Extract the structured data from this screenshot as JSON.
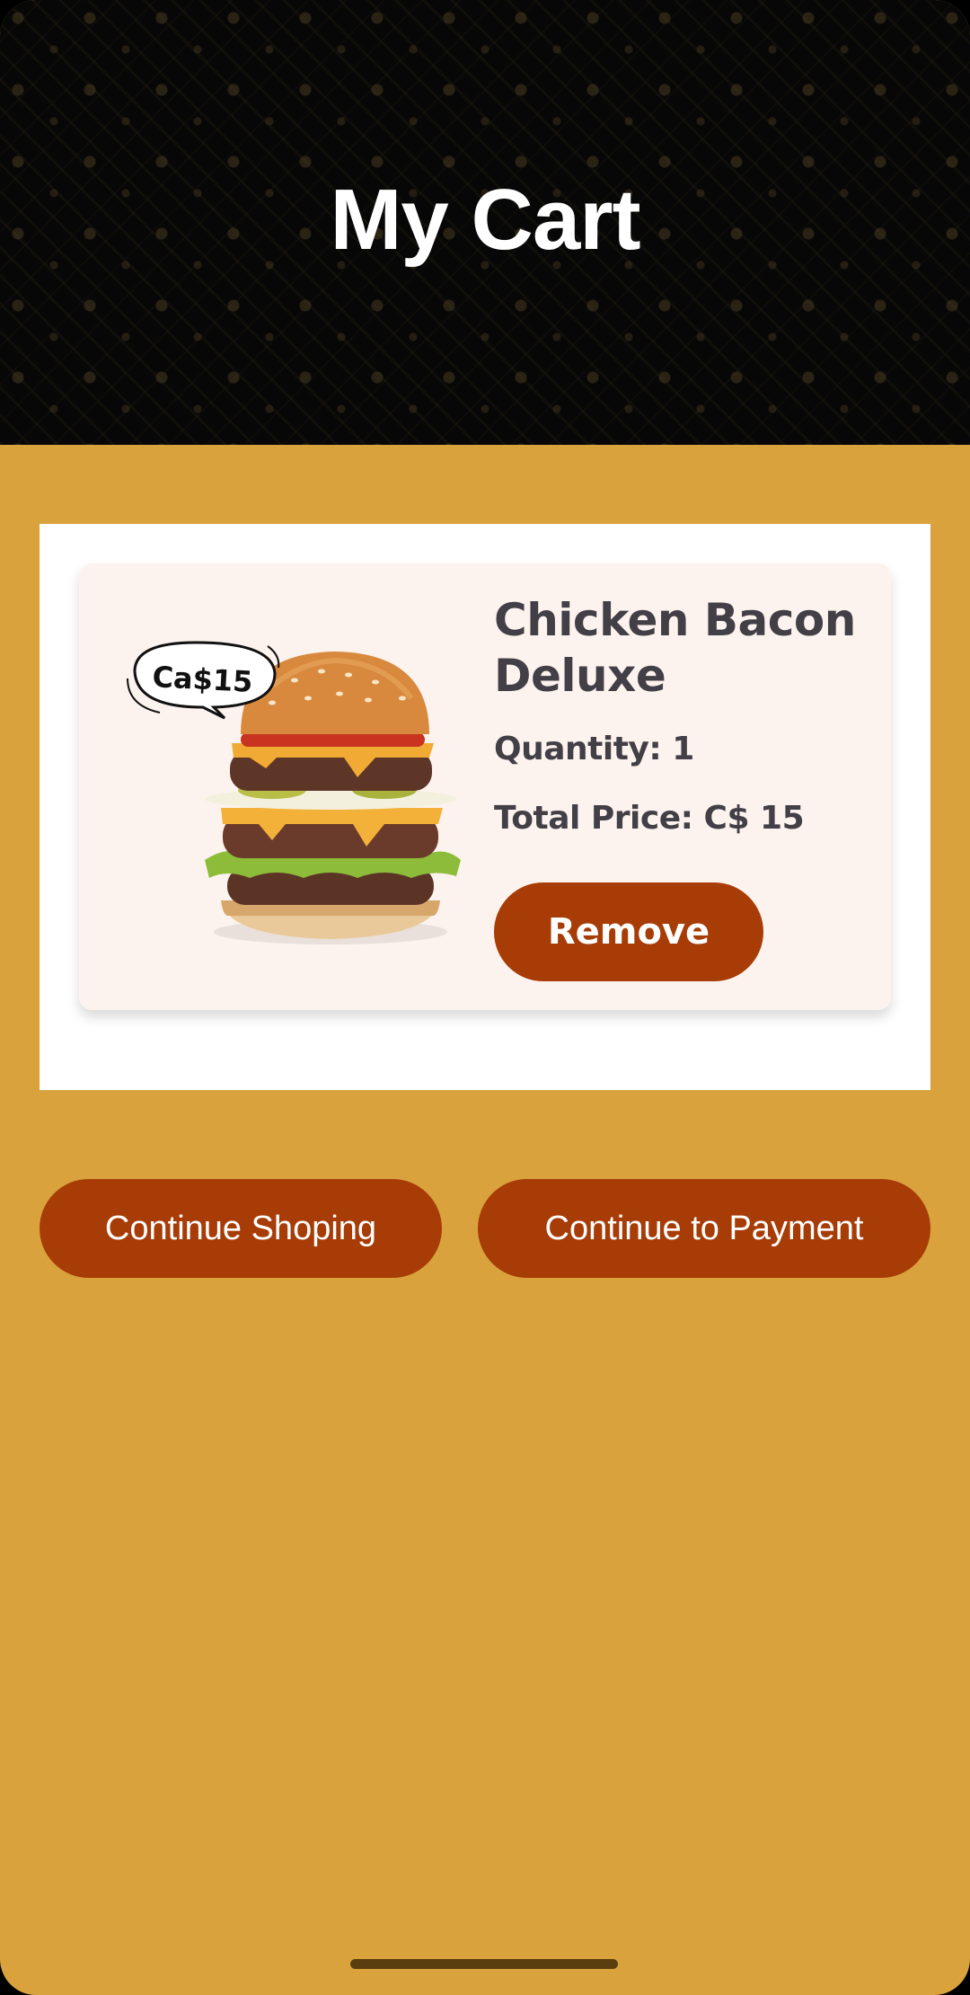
{
  "header": {
    "title": "My Cart"
  },
  "cart": {
    "items": [
      {
        "name": "Chicken Bacon Deluxe",
        "quantity_text": "Quantity: 1",
        "total_text": "Total Price: C$ 15",
        "price_tag": "Ca$15",
        "remove_label": "Remove",
        "image_icon": "burger-image"
      }
    ]
  },
  "actions": {
    "continue_shopping_label": "Continue Shoping",
    "continue_payment_label": "Continue to Payment"
  },
  "colors": {
    "background": "#D9A23D",
    "header": "#070707",
    "button": "#A73C06",
    "card": "#FDF3EE",
    "text_dark": "#423F47"
  }
}
